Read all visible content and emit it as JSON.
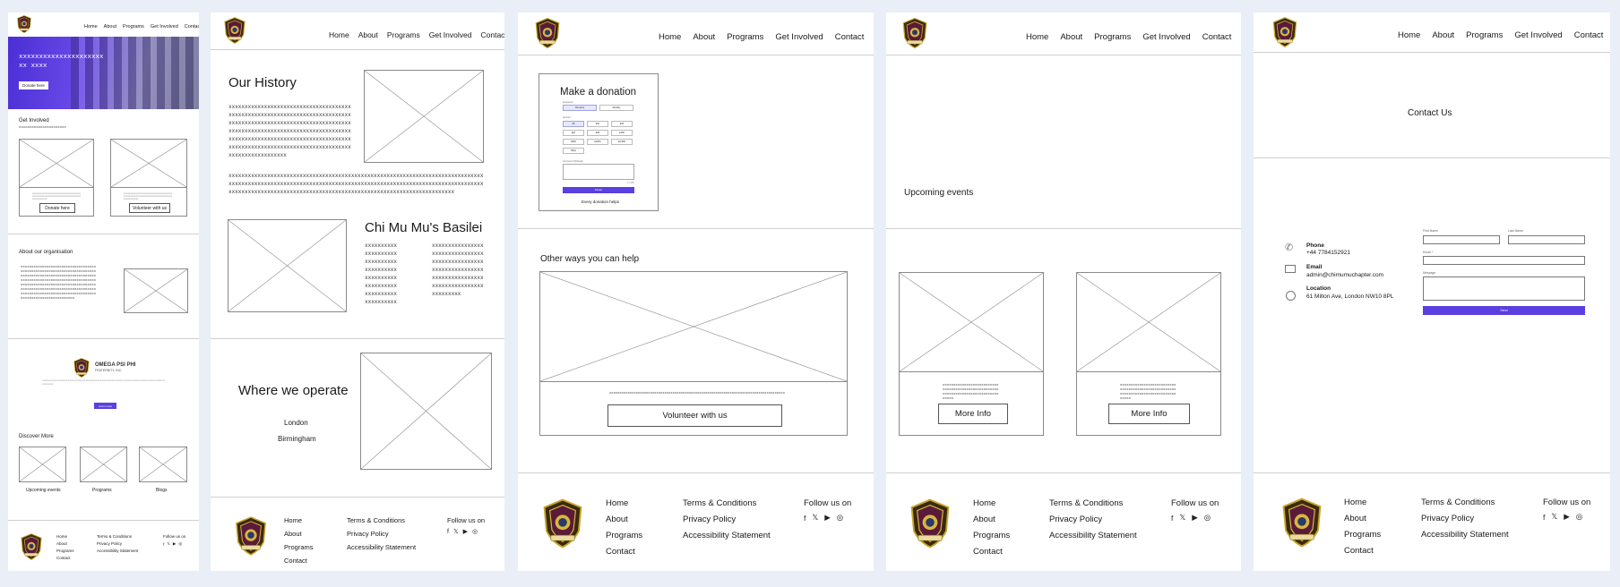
{
  "nav": [
    "Home",
    "About",
    "Programs",
    "Get Involved",
    "Contact"
  ],
  "footer": {
    "links1": [
      "Home",
      "About",
      "Programs",
      "Contact"
    ],
    "links2": [
      "Terms & Conditions",
      "Privacy Policy",
      "Accessibility Statement"
    ],
    "follow": "Follow us on",
    "social": [
      "f",
      "𝕏",
      "▶",
      "◎"
    ]
  },
  "home": {
    "hero_text": "xxxxxxxxxxxxxxxxxxxxxxx xxxx",
    "donate_btn": "Donate here",
    "get_involved_title": "Get Involved",
    "get_involved_sub": "xxxxxxxxxxxxxxxxxxxxxx",
    "card_btns": [
      "Donate here",
      "Volunteer with us"
    ],
    "about_title": "About our organisation",
    "about_text": "xxxxxxxxxxxxxxxxxxxxxxxxxxxxxxxxxxxxxxxxxxxxxxxxxxxxxxxxxxxxxxxxxxxxxxxxxxxxxxxxxxxxxxxxxxxxxxxxxxxxxxxxxxxxxxxxxxxxxxxxxxxxxxxxxxxxxxxxxxxxxxxxxxxxxxxxxxxxxxxxxxxxxxxxxxxxxxxxxxxxxxxxxxxxxxxxxxxxxxxxxxxxxxxxxxxxxxxxxxxxxxxxxxxxxxxxxxxxxxxxxxxxxxxxxxxxxxxxxxxxxxxxxxxxxx",
    "omega_name": "OMEGA PSI PHI",
    "omega_sub": "FRATERNITY, INC.",
    "learn_more": "Learn more",
    "discover_title": "Discover More",
    "discover": [
      "Upcoming events",
      "Programs",
      "Blogs"
    ]
  },
  "about": {
    "history_title": "Our History",
    "history_text": "xxxxxxxxxxxxxxxxxxxxxxxxxxxxxxxxxxxxxxxxxxxxxxxxxxxxxxxxxxxxxxxxxxxxxxxxxxxxxxxxxxxxxxxxxxxxxxxxxxxxxxxxxxxxxxxxxxxxxxxxxxxxxxxxxxxxxxxxxxxxxxxxxxxxxxxxxxxxxxxxxxxxxxxxxxxxxxxxxxxxxxxxxxxxxxxxxxxxxxxxxxxxxxxxxxxxxxxxxxxxxxxxxxxxxxxxxxxxxxxxxxxxxx",
    "history_wide": "xxxxxxxxxxxxxxxxxxxxxxxxxxxxxxxxxxxxxxxxxxxxxxxxxxxxxxxxxxxxxxxxxxxxxxxxxxxxxxxxxxxxxxxxxxxxxxxxxxxxxxxxxxxxxxxxxxxxxxxxxxxxxxxxxxxxxxxxxxxxxxxxxxxxxxxxxxxxxxxxxxxxxxxxxxxxxxxxxxxxxxxxxxxxxxxxxxxxxxxxxxxxxxxxxxxxxxxxxxxxxxxxxxxx",
    "basilei_title": "Chi Mu Mu's Basilei",
    "basilei_col1": "xxxxxxxxxxxxxxxxxxxxxxxxxxxxxxxxxxxxxxxxxxxxxxxxxxxxxxxxxxxxxxxxxxxxxxxxxxxxxxxxxxxxxxxxxxx",
    "basilei_col2": "xxxxxxxxxxxxxxxxxxxxxxxxxxxxxxxxxxxxxxxxxxxxxxxxxxxxxxxxxxxxxxxxxxxxxxxxxxxxxxxxxxxxxxxxxxxxxxxxxxxxxxxxx",
    "operate_title": "Where we operate",
    "cities": [
      "London",
      "Birmingham"
    ]
  },
  "getinvolved": {
    "donation_title": "Make a donation",
    "frequency_label": "Frequency",
    "frequency": [
      "One-time",
      "Monthly"
    ],
    "amount_label": "Amount",
    "amounts": [
      "£5",
      "£10",
      "£15",
      "£20",
      "£25",
      "£100",
      "£500",
      "£1000",
      "£2,500",
      "Other"
    ],
    "comment_label": "Comment (Optional)",
    "counter": "0 / 200",
    "submit": "Donate",
    "every_helps": "Every donation helps",
    "other_ways_title": "Other ways you can help",
    "other_text": "xxxxxxxxxxxxxxxxxxxxxxxxxxxxxxxxxxxxxxxxxxxxxxxxxxxxxxxxxxxxxxxxxxxxxxxxxxxxxxxxxxxxxx",
    "volunteer_btn": "Volunteer with us"
  },
  "programs": {
    "upcoming_title": "Upcoming events",
    "card_text": "xxxxxxxxxxxxxxxxxxxxxxxxxxxxxxxxxxxxxxxxxxxxxxxxxxxxxxxxxxxxxxxxxxxxxxxxxxxxxxxxxxx",
    "more_info": "More Info"
  },
  "contact": {
    "title": "Contact Us",
    "phone_label": "Phone",
    "phone_value": "+44 7784152921",
    "email_label": "Email",
    "email_value": "admin@chimumuchapter.com",
    "location_label": "Location",
    "location_value": "61 Milton Ave, London NW10 8PL",
    "first_name": "First Name",
    "last_name": "Last Name",
    "email_field": "Email *",
    "message_field": "Message",
    "send": "Send"
  },
  "colors": {
    "accent": "#5b3fe0",
    "background": "#eaeef7"
  }
}
